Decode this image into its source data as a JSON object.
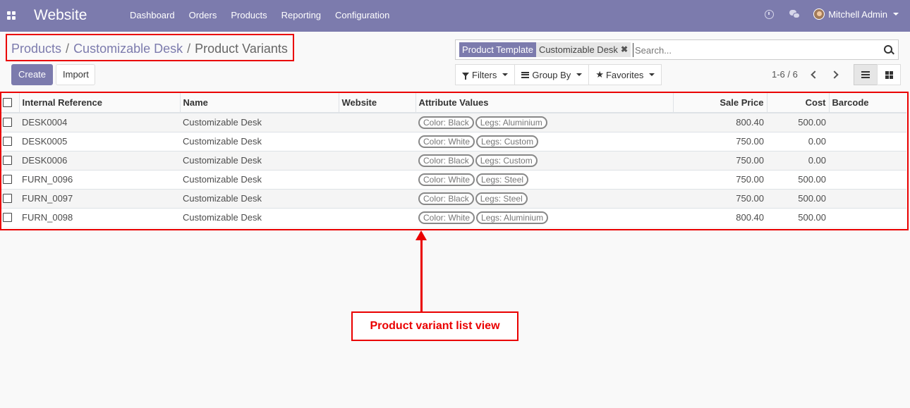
{
  "navbar": {
    "app_title": "Website",
    "menu": [
      "Dashboard",
      "Orders",
      "Products",
      "Reporting",
      "Configuration"
    ],
    "user_name": "Mitchell Admin"
  },
  "breadcrumb": {
    "items": [
      "Products",
      "Customizable Desk"
    ],
    "separator": "/",
    "active": "Product Variants"
  },
  "buttons": {
    "create": "Create",
    "import": "Import"
  },
  "search": {
    "facet_label": "Product Template",
    "facet_value": "Customizable Desk",
    "facet_remove": "✖",
    "placeholder": "Search..."
  },
  "filters": {
    "filters": "Filters",
    "group_by": "Group By",
    "favorites": "Favorites"
  },
  "pager": {
    "value": "1-6 / 6"
  },
  "table": {
    "columns": [
      "Internal Reference",
      "Name",
      "Website",
      "Attribute Values",
      "Sale Price",
      "Cost",
      "Barcode"
    ],
    "rows": [
      {
        "ref": "DESK0004",
        "name": "Customizable Desk",
        "website": "",
        "attrs": [
          "Color: Black",
          "Legs: Aluminium"
        ],
        "price": "800.40",
        "cost": "500.00",
        "barcode": ""
      },
      {
        "ref": "DESK0005",
        "name": "Customizable Desk",
        "website": "",
        "attrs": [
          "Color: White",
          "Legs: Custom"
        ],
        "price": "750.00",
        "cost": "0.00",
        "barcode": ""
      },
      {
        "ref": "DESK0006",
        "name": "Customizable Desk",
        "website": "",
        "attrs": [
          "Color: Black",
          "Legs: Custom"
        ],
        "price": "750.00",
        "cost": "0.00",
        "barcode": ""
      },
      {
        "ref": "FURN_0096",
        "name": "Customizable Desk",
        "website": "",
        "attrs": [
          "Color: White",
          "Legs: Steel"
        ],
        "price": "750.00",
        "cost": "500.00",
        "barcode": ""
      },
      {
        "ref": "FURN_0097",
        "name": "Customizable Desk",
        "website": "",
        "attrs": [
          "Color: Black",
          "Legs: Steel"
        ],
        "price": "750.00",
        "cost": "500.00",
        "barcode": ""
      },
      {
        "ref": "FURN_0098",
        "name": "Customizable Desk",
        "website": "",
        "attrs": [
          "Color: White",
          "Legs: Aluminium"
        ],
        "price": "800.40",
        "cost": "500.00",
        "barcode": ""
      }
    ]
  },
  "annotation": {
    "label": "Product variant list view",
    "color": "#ea0000"
  },
  "colors": {
    "brand": "#7c7bad"
  }
}
